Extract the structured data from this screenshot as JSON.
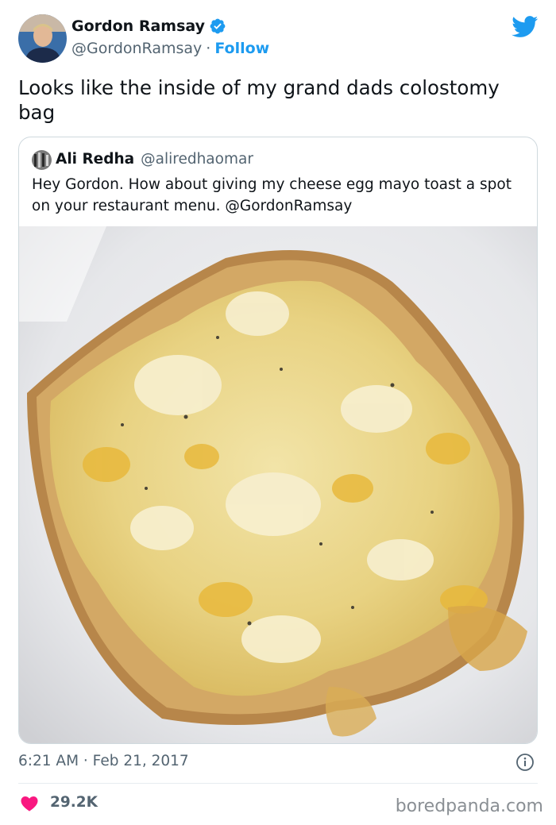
{
  "author": {
    "name": "Gordon Ramsay",
    "handle": "@GordonRamsay",
    "separator": "·",
    "follow_label": "Follow"
  },
  "tweet": {
    "text": "Looks like the inside of my grand dads colostomy bag",
    "timestamp": "6:21 AM · Feb 21, 2017",
    "likes": "29.2K"
  },
  "quoted": {
    "name": "Ali Redha",
    "handle": "@aliredhaomar",
    "text": "Hey Gordon. How about giving my cheese egg mayo toast a spot on your restaurant menu. @GordonRamsay"
  },
  "watermark": "boredpanda.com",
  "colors": {
    "twitter_blue": "#1d9bf0",
    "like_pink": "#f91880",
    "text_gray": "#536471",
    "border": "#cfd9de"
  },
  "icons": {
    "verified": "verified-badge-icon",
    "brand": "twitter-bird-icon",
    "info": "info-icon",
    "like": "heart-icon"
  }
}
